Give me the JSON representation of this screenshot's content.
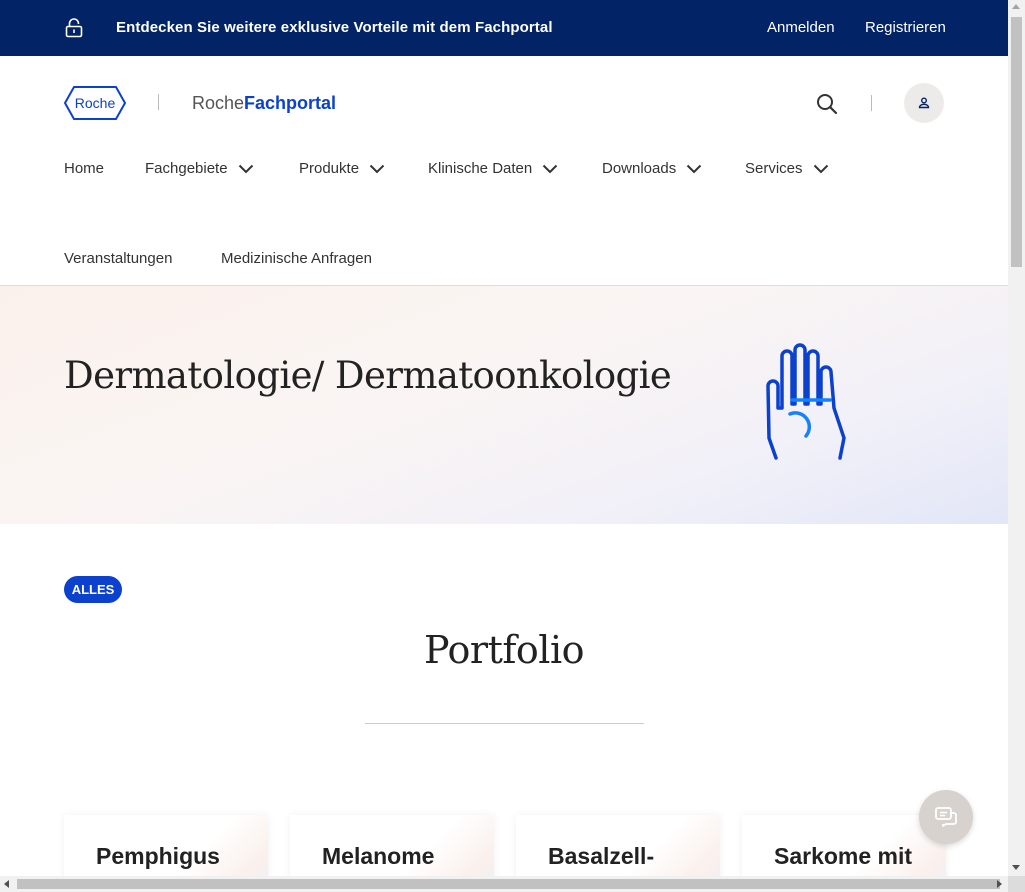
{
  "topbar": {
    "promo": "Entdecken Sie weitere exklusive Vorteile mit dem Fachportal",
    "login": "Anmelden",
    "register": "Registrieren",
    "background": "#022366",
    "icon": "lock-open-icon"
  },
  "header": {
    "logo_text": "Roche",
    "portal_name_prefix": "Roche",
    "portal_name_bold": "Fachportal",
    "brand_color": "#0b41cd"
  },
  "nav": {
    "items": [
      {
        "label": "Home"
      },
      {
        "label": "Fachgebiete"
      },
      {
        "label": "Produkte"
      },
      {
        "label": "Klinische Daten"
      },
      {
        "label": "Downloads"
      },
      {
        "label": "Services"
      },
      {
        "label": "Veranstaltungen"
      },
      {
        "label": "Medizinische Anfragen"
      }
    ]
  },
  "hero": {
    "title": "Dermatologie/ Dermatoonkologie",
    "icon": "hand-icon"
  },
  "filter": {
    "chip": "ALLES"
  },
  "portfolio": {
    "title": "Portfolio",
    "cards": [
      {
        "title": "Pemphigus"
      },
      {
        "title": "Melanome"
      },
      {
        "title": "Basalzell-"
      },
      {
        "title": "Sarkome mit"
      }
    ]
  }
}
